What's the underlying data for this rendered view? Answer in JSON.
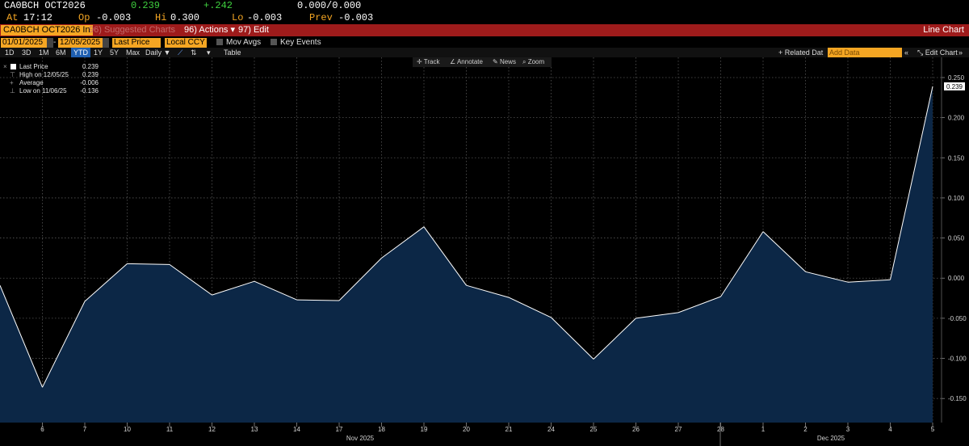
{
  "quote": {
    "ticker": "CA0BCH OCT2026",
    "last": "0.239",
    "change": "+.242",
    "bid_ask": "0.000/0.000",
    "at_label": "At",
    "time": "17:12",
    "open_label": "Op",
    "open": "-0.003",
    "hi_label": "Hi",
    "hi": "0.300",
    "lo_label": "Lo",
    "lo": "-0.003",
    "prev_label": "Prev",
    "prev": "-0.003"
  },
  "menubar": {
    "ticker_field": "CA0BCH OCT2026 In",
    "suggested": "96) Suggested Charts",
    "actions_num": "96)",
    "actions": "Actions",
    "edit_num": "97)",
    "edit": "Edit",
    "chart_type": "Line Chart"
  },
  "params": {
    "start_date": "01/01/2025",
    "dash": "-",
    "end_date": "12/05/2025",
    "field": "Last Price",
    "currency": "Local CCY",
    "mov_avgs": "Mov Avgs",
    "key_events": "Key Events"
  },
  "toolbar": {
    "periods": [
      "1D",
      "3D",
      "1M",
      "6M",
      "YTD",
      "1Y",
      "5Y",
      "Max"
    ],
    "active_period": "YTD",
    "frequency": "Daily",
    "table": "Table",
    "related": "Related Dat",
    "add_data": "Add Data",
    "edit_chart": "Edit Chart"
  },
  "tools": {
    "track": "Track",
    "annotate": "Annotate",
    "news": "News",
    "zoom": "Zoom"
  },
  "legend": {
    "last_label": "Last Price",
    "last_value": "0.239",
    "high_label": "High on 12/05/25",
    "high_value": "0.239",
    "avg_label": "Average",
    "avg_value": "-0.006",
    "low_label": "Low on 11/06/25",
    "low_value": "-0.136"
  },
  "colors": {
    "amber": "#f5a623",
    "header_red": "#9e1b1b",
    "line": "#ffffff",
    "area_fill": "#0c2746",
    "grid": "#555555"
  },
  "chart_data": {
    "type": "area",
    "x_ticks": [
      "6",
      "7",
      "10",
      "11",
      "12",
      "13",
      "14",
      "17",
      "18",
      "19",
      "20",
      "21",
      "24",
      "25",
      "26",
      "27",
      "28",
      "1",
      "2",
      "3",
      "4",
      "5"
    ],
    "month_labels": [
      {
        "label": "Nov 2025",
        "at_index": 8
      },
      {
        "label": "Dec 2025",
        "at_index": 18.5
      }
    ],
    "x": [
      "2025-11-05",
      "2025-11-06",
      "2025-11-07",
      "2025-11-10",
      "2025-11-11",
      "2025-11-12",
      "2025-11-13",
      "2025-11-14",
      "2025-11-17",
      "2025-11-18",
      "2025-11-19",
      "2025-11-20",
      "2025-11-21",
      "2025-11-24",
      "2025-11-25",
      "2025-11-26",
      "2025-11-27",
      "2025-11-28",
      "2025-12-01",
      "2025-12-02",
      "2025-12-03",
      "2025-12-04",
      "2025-12-05"
    ],
    "values": [
      -0.009,
      -0.136,
      -0.029,
      0.018,
      0.017,
      -0.021,
      -0.004,
      -0.027,
      -0.028,
      0.025,
      0.064,
      -0.009,
      -0.024,
      -0.049,
      -0.101,
      -0.05,
      -0.043,
      -0.023,
      0.058,
      0.008,
      -0.005,
      -0.002,
      0.239
    ],
    "y_ticks": [
      0.25,
      0.2,
      0.15,
      0.1,
      0.05,
      0.0,
      -0.05,
      -0.1,
      -0.15
    ],
    "y_tick_labels": [
      "0.250",
      "0.200",
      "0.150",
      "0.100",
      "0.050",
      "0.000",
      "-0.050",
      "-0.100",
      "-0.150"
    ],
    "ylim": [
      -0.18,
      0.255
    ],
    "last_value_label": "0.239",
    "grid": true
  }
}
